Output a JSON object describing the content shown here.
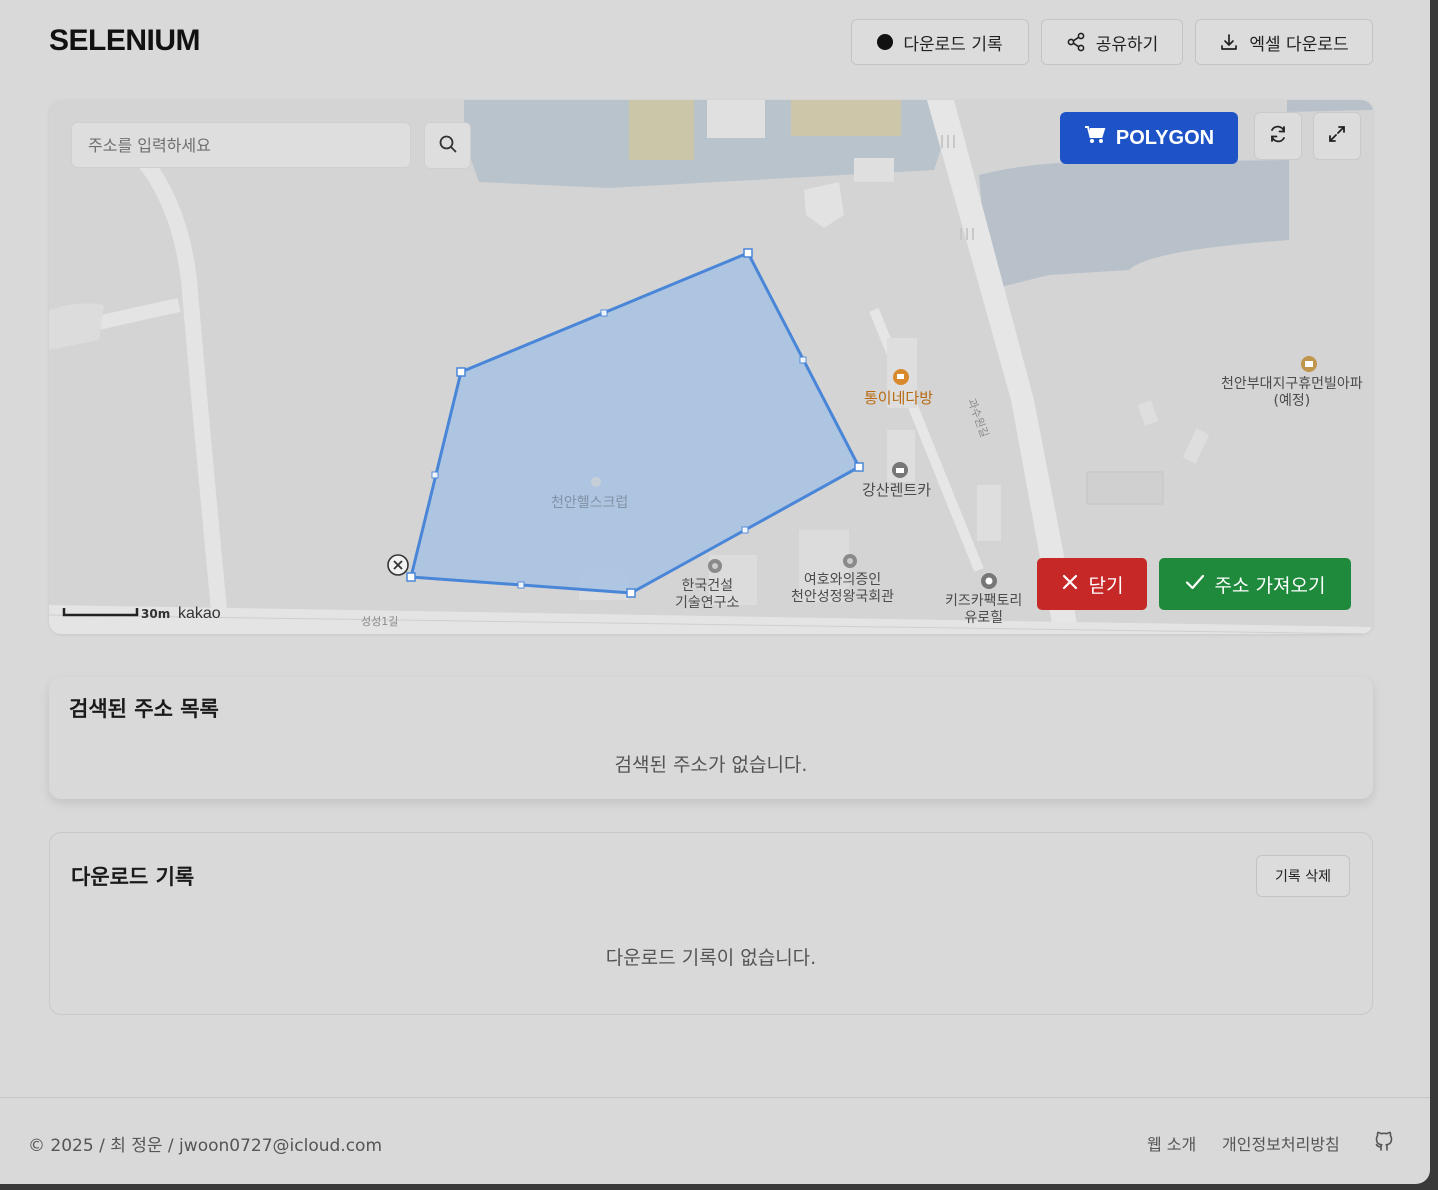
{
  "header": {
    "logo": "SELENIUM",
    "buttons": {
      "history": "다운로드 기록",
      "share": "공유하기",
      "excel": "엑셀 다운로드"
    }
  },
  "map": {
    "search_placeholder": "주소를 입력하세요",
    "polygon_label": "POLYGON",
    "close_label": "닫기",
    "import_label": "주소 가져오기",
    "scale": "30m",
    "attribution": "kakao",
    "places": {
      "gym": "천안헬스크럽",
      "cafe": "통이네다방",
      "rentcar": "강산렌트카",
      "apartment_line1": "천안부대지구휴먼빌아파",
      "apartment_line2": "(예정)",
      "institute_line1": "한국건설",
      "institute_line2": "기술연구소",
      "hall_line1": "여호와의증인",
      "hall_line2": "천안성정왕국회관",
      "kids_line1": "키즈카팩토리",
      "kids_line2": "유로힐",
      "road_bottom": "성성1길",
      "road_right": "과수원길"
    }
  },
  "address_list": {
    "title": "검색된 주소 목록",
    "empty": "검색된 주소가 없습니다."
  },
  "download_history": {
    "title": "다운로드 기록",
    "delete_label": "기록 삭제",
    "empty": "다운로드 기록이 없습니다."
  },
  "footer": {
    "copyright": "© 2025 / 최 정운 / jwoon0727@icloud.com",
    "about": "웹 소개",
    "privacy": "개인정보처리방침"
  },
  "colors": {
    "polygon_fill": "#a9c3e3",
    "polygon_stroke": "#4a86d8",
    "primary_blue": "#1e53c8",
    "danger_red": "#c62828",
    "success_green": "#1f8a3c"
  }
}
